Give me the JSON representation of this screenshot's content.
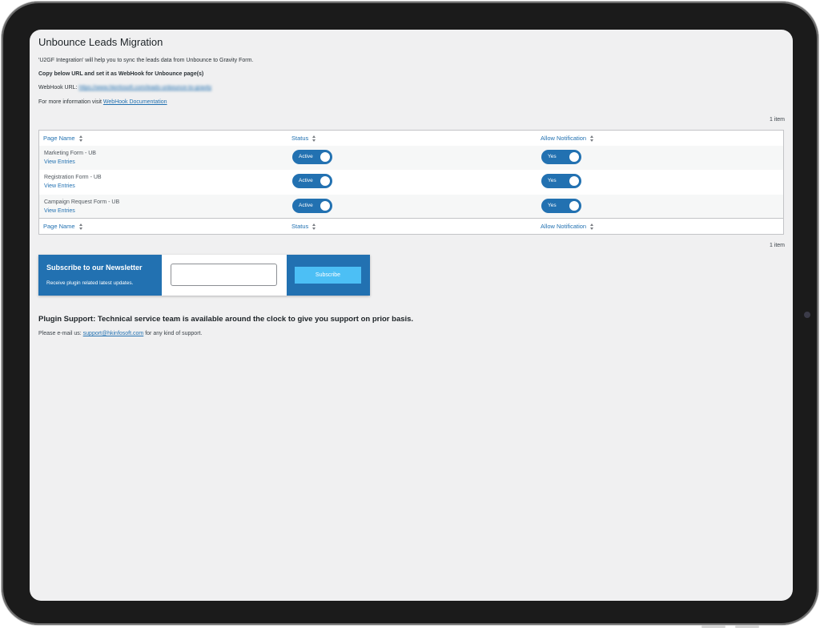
{
  "page": {
    "title": "Unbounce Leads Migration",
    "intro": "'U2GF Integration' will help you to sync the leads data from Unbounce to Gravity Form.",
    "copy_instruction": "Copy below URL and set it as WebHook for Unbounce page(s)",
    "webhook_label": "WebHook URL:",
    "webhook_url": "https://www.hkinfosoft.com/leads-unbounce-to-gravity",
    "more_info_prefix": "For more information visit",
    "more_info_link": "WebHook Documentation"
  },
  "table": {
    "count_top": "1 item",
    "count_bottom": "1 item",
    "columns": [
      "Page Name",
      "Status",
      "Allow Notification"
    ],
    "rows": [
      {
        "name": "Marketing Form - UB",
        "link": "View Entries",
        "status": "Active",
        "notification": "Yes"
      },
      {
        "name": "Registration Form - UB",
        "link": "View Entries",
        "status": "Active",
        "notification": "Yes"
      },
      {
        "name": "Campaign Request Form - UB",
        "link": "View Entries",
        "status": "Active",
        "notification": "Yes"
      }
    ]
  },
  "newsletter": {
    "title": "Subscribe to our Newsletter",
    "subtitle": "Receive plugin related latest updates.",
    "email_value": "",
    "button": "Subscribe"
  },
  "support": {
    "title": "Plugin Support: Technical service team is available around the clock to give you support on prior basis.",
    "prefix": "Please e-mail us:",
    "email": "support@hkinfosoft.com",
    "suffix": "for any kind of support."
  },
  "colors": {
    "accent": "#2271b1",
    "subscribe_button": "#4cbff5",
    "background": "#f0f0f1",
    "bezel": "#1b1b1b"
  },
  "icons": {
    "sort": "sort-arrows-icon",
    "camera": "camera-icon"
  }
}
